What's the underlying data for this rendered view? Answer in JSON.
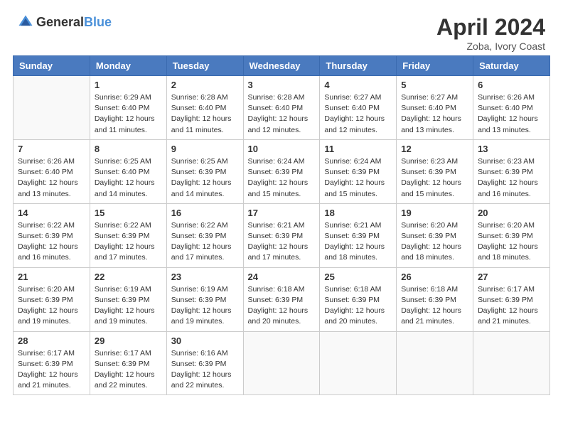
{
  "header": {
    "logo_general": "General",
    "logo_blue": "Blue",
    "month": "April 2024",
    "location": "Zoba, Ivory Coast"
  },
  "days_of_week": [
    "Sunday",
    "Monday",
    "Tuesday",
    "Wednesday",
    "Thursday",
    "Friday",
    "Saturday"
  ],
  "weeks": [
    [
      {
        "day": "",
        "info": ""
      },
      {
        "day": "1",
        "info": "Sunrise: 6:29 AM\nSunset: 6:40 PM\nDaylight: 12 hours\nand 11 minutes."
      },
      {
        "day": "2",
        "info": "Sunrise: 6:28 AM\nSunset: 6:40 PM\nDaylight: 12 hours\nand 11 minutes."
      },
      {
        "day": "3",
        "info": "Sunrise: 6:28 AM\nSunset: 6:40 PM\nDaylight: 12 hours\nand 12 minutes."
      },
      {
        "day": "4",
        "info": "Sunrise: 6:27 AM\nSunset: 6:40 PM\nDaylight: 12 hours\nand 12 minutes."
      },
      {
        "day": "5",
        "info": "Sunrise: 6:27 AM\nSunset: 6:40 PM\nDaylight: 12 hours\nand 13 minutes."
      },
      {
        "day": "6",
        "info": "Sunrise: 6:26 AM\nSunset: 6:40 PM\nDaylight: 12 hours\nand 13 minutes."
      }
    ],
    [
      {
        "day": "7",
        "info": "Sunrise: 6:26 AM\nSunset: 6:40 PM\nDaylight: 12 hours\nand 13 minutes."
      },
      {
        "day": "8",
        "info": "Sunrise: 6:25 AM\nSunset: 6:40 PM\nDaylight: 12 hours\nand 14 minutes."
      },
      {
        "day": "9",
        "info": "Sunrise: 6:25 AM\nSunset: 6:39 PM\nDaylight: 12 hours\nand 14 minutes."
      },
      {
        "day": "10",
        "info": "Sunrise: 6:24 AM\nSunset: 6:39 PM\nDaylight: 12 hours\nand 15 minutes."
      },
      {
        "day": "11",
        "info": "Sunrise: 6:24 AM\nSunset: 6:39 PM\nDaylight: 12 hours\nand 15 minutes."
      },
      {
        "day": "12",
        "info": "Sunrise: 6:23 AM\nSunset: 6:39 PM\nDaylight: 12 hours\nand 15 minutes."
      },
      {
        "day": "13",
        "info": "Sunrise: 6:23 AM\nSunset: 6:39 PM\nDaylight: 12 hours\nand 16 minutes."
      }
    ],
    [
      {
        "day": "14",
        "info": "Sunrise: 6:22 AM\nSunset: 6:39 PM\nDaylight: 12 hours\nand 16 minutes."
      },
      {
        "day": "15",
        "info": "Sunrise: 6:22 AM\nSunset: 6:39 PM\nDaylight: 12 hours\nand 17 minutes."
      },
      {
        "day": "16",
        "info": "Sunrise: 6:22 AM\nSunset: 6:39 PM\nDaylight: 12 hours\nand 17 minutes."
      },
      {
        "day": "17",
        "info": "Sunrise: 6:21 AM\nSunset: 6:39 PM\nDaylight: 12 hours\nand 17 minutes."
      },
      {
        "day": "18",
        "info": "Sunrise: 6:21 AM\nSunset: 6:39 PM\nDaylight: 12 hours\nand 18 minutes."
      },
      {
        "day": "19",
        "info": "Sunrise: 6:20 AM\nSunset: 6:39 PM\nDaylight: 12 hours\nand 18 minutes."
      },
      {
        "day": "20",
        "info": "Sunrise: 6:20 AM\nSunset: 6:39 PM\nDaylight: 12 hours\nand 18 minutes."
      }
    ],
    [
      {
        "day": "21",
        "info": "Sunrise: 6:20 AM\nSunset: 6:39 PM\nDaylight: 12 hours\nand 19 minutes."
      },
      {
        "day": "22",
        "info": "Sunrise: 6:19 AM\nSunset: 6:39 PM\nDaylight: 12 hours\nand 19 minutes."
      },
      {
        "day": "23",
        "info": "Sunrise: 6:19 AM\nSunset: 6:39 PM\nDaylight: 12 hours\nand 19 minutes."
      },
      {
        "day": "24",
        "info": "Sunrise: 6:18 AM\nSunset: 6:39 PM\nDaylight: 12 hours\nand 20 minutes."
      },
      {
        "day": "25",
        "info": "Sunrise: 6:18 AM\nSunset: 6:39 PM\nDaylight: 12 hours\nand 20 minutes."
      },
      {
        "day": "26",
        "info": "Sunrise: 6:18 AM\nSunset: 6:39 PM\nDaylight: 12 hours\nand 21 minutes."
      },
      {
        "day": "27",
        "info": "Sunrise: 6:17 AM\nSunset: 6:39 PM\nDaylight: 12 hours\nand 21 minutes."
      }
    ],
    [
      {
        "day": "28",
        "info": "Sunrise: 6:17 AM\nSunset: 6:39 PM\nDaylight: 12 hours\nand 21 minutes."
      },
      {
        "day": "29",
        "info": "Sunrise: 6:17 AM\nSunset: 6:39 PM\nDaylight: 12 hours\nand 22 minutes."
      },
      {
        "day": "30",
        "info": "Sunrise: 6:16 AM\nSunset: 6:39 PM\nDaylight: 12 hours\nand 22 minutes."
      },
      {
        "day": "",
        "info": ""
      },
      {
        "day": "",
        "info": ""
      },
      {
        "day": "",
        "info": ""
      },
      {
        "day": "",
        "info": ""
      }
    ]
  ]
}
